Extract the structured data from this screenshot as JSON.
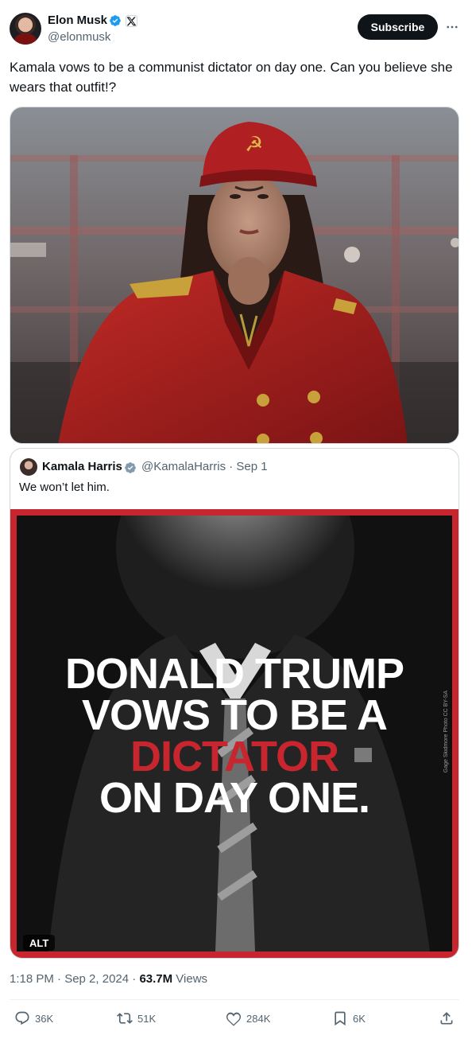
{
  "author": {
    "name": "Elon Musk",
    "handle": "@elonmusk",
    "subscribe_label": "Subscribe"
  },
  "tweet": {
    "text": "Kamala vows to be a communist dictator on day one. Can you believe she wears that outfit!?"
  },
  "quoted": {
    "name": "Kamala Harris",
    "handle_date": "@KamalaHarris · Sep 1",
    "text": "We won’t let him.",
    "image": {
      "line1": "DONALD TRUMP",
      "line2": "VOWS TO BE A",
      "line3": "DICTATOR",
      "line4": "ON DAY ONE.",
      "credit": "Gage Skidmore Photo CC BY-SA",
      "alt_badge": "ALT"
    }
  },
  "meta": {
    "time_date": "1:18 PM · Sep 2, 2024 · ",
    "views_count": "63.7M",
    "views_label": " Views"
  },
  "actions": {
    "replies": "36K",
    "reposts": "51K",
    "likes": "284K",
    "bookmarks": "6K"
  },
  "icons": [
    "verified-icon",
    "x-logo-icon",
    "more-icon",
    "reply-icon",
    "repost-icon",
    "like-icon",
    "bookmark-icon",
    "share-icon"
  ],
  "colors": {
    "accent": "#1d9bf0",
    "poster_red": "#c8262f",
    "text": "#0f1419",
    "muted": "#536471"
  }
}
